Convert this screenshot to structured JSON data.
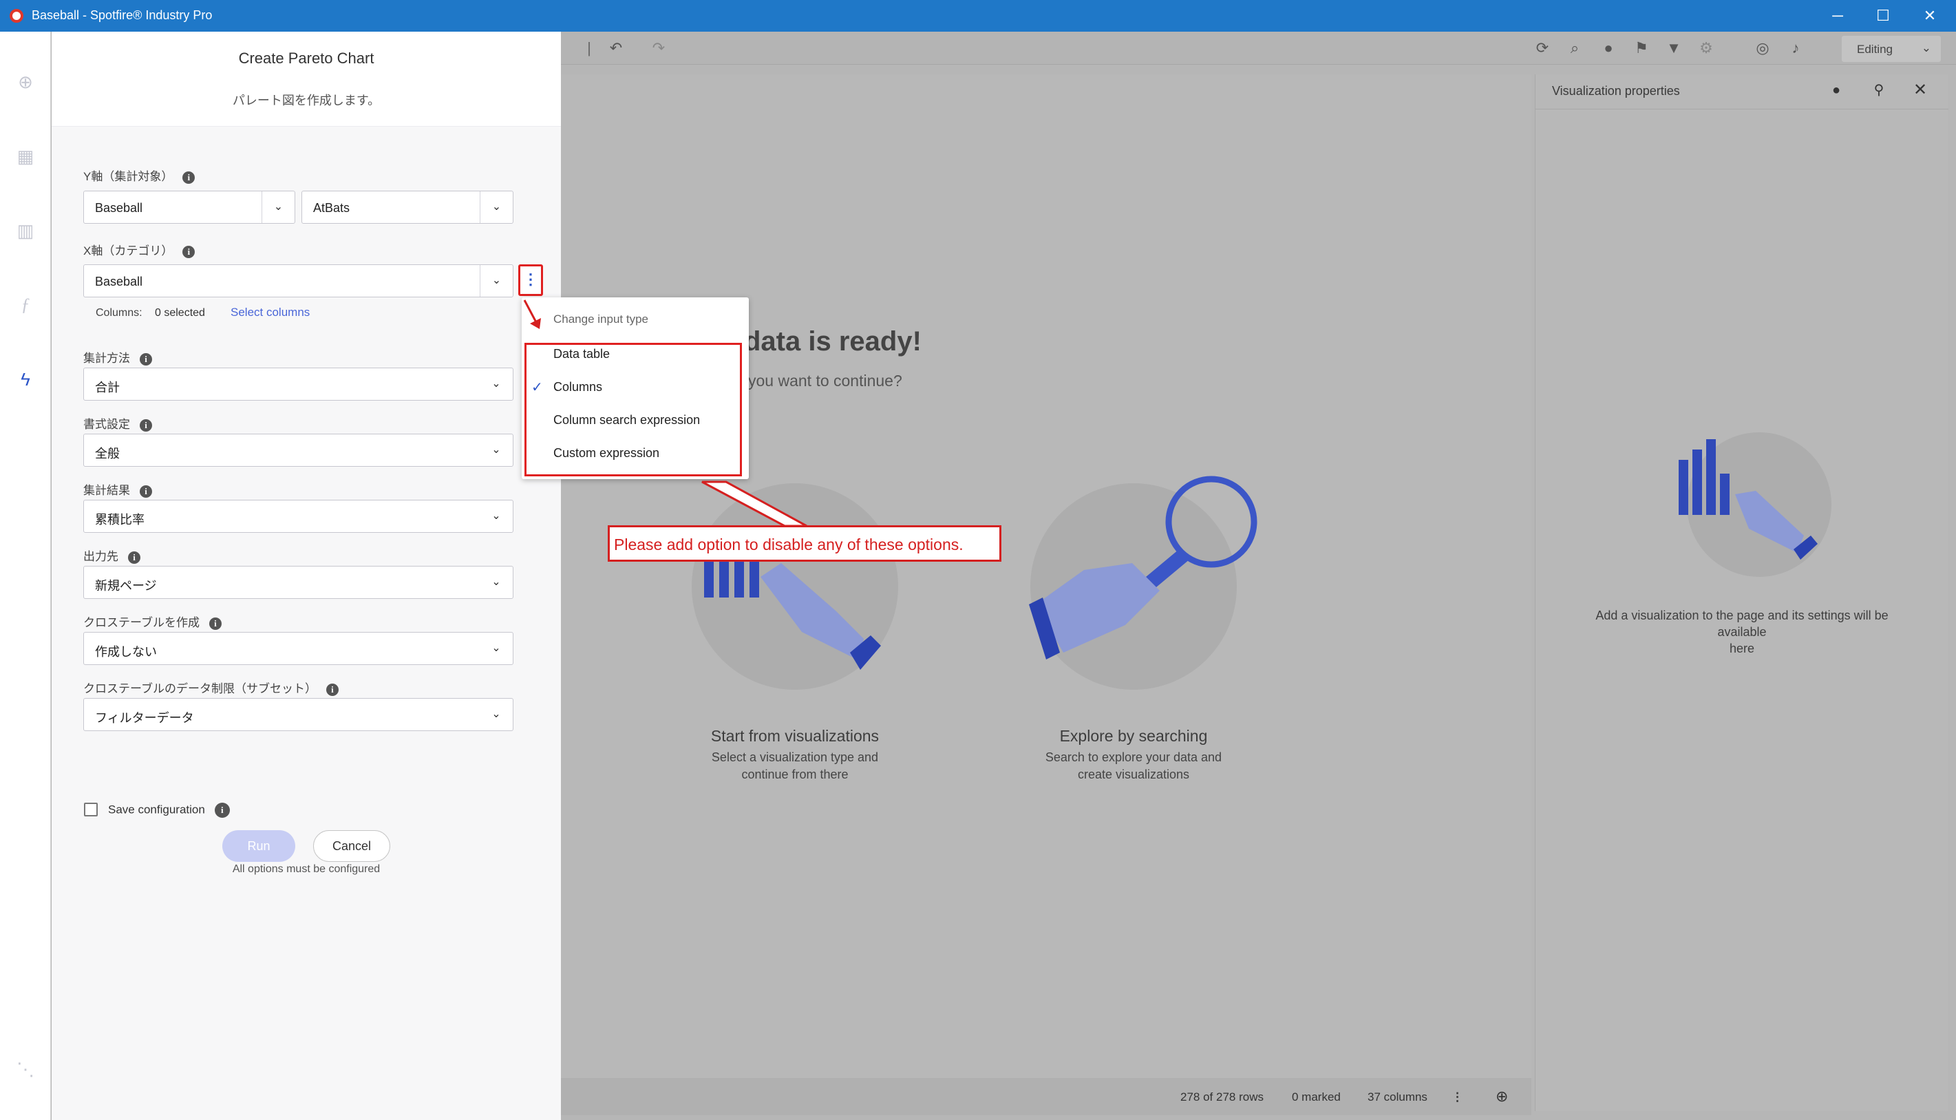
{
  "window": {
    "title": "Baseball - Spotfire® Industry Pro",
    "icons": [
      "app-icon",
      "minimize-icon",
      "maximize-icon",
      "close-icon"
    ]
  },
  "rail": {
    "icons": [
      "add-icon",
      "data-table-icon",
      "bar-chart-icon",
      "formula-icon",
      "lightning-icon",
      "tree-icon"
    ]
  },
  "toolbar": {
    "icons": [
      "undo-icon",
      "redo-icon",
      "refresh-icon",
      "search-icon",
      "comment-icon",
      "bookmark-icon",
      "filter-icon",
      "gear-icon",
      "compass-icon",
      "bell-icon"
    ],
    "mode_label": "Editing"
  },
  "dialog": {
    "title": "Create Pareto Chart",
    "subtitle": "パレート図を作成します。",
    "y_axis": {
      "label": "Y軸（集計対象）",
      "table_value": "Baseball",
      "column_value": "AtBats"
    },
    "x_axis": {
      "label": "X軸（カテゴリ）",
      "table_value": "Baseball",
      "columns_label": "Columns:",
      "columns_selected": "0 selected",
      "select_columns_link": "Select columns"
    },
    "aggregation": {
      "label": "集計方法",
      "value": "合計"
    },
    "format": {
      "label": "書式設定",
      "value": "全般"
    },
    "result": {
      "label": "集計結果",
      "value": "累積比率"
    },
    "output": {
      "label": "出力先",
      "value": "新規ページ"
    },
    "crosstable": {
      "label": "クロステーブルを作成",
      "value": "作成しない"
    },
    "crosstable_limit": {
      "label": "クロステーブルのデータ制限（サブセット）",
      "value": "フィルターデータ"
    },
    "save_config_label": "Save configuration",
    "run_label": "Run",
    "cancel_label": "Cancel",
    "footer_note": "All options must be configured"
  },
  "menu": {
    "header": "Change input type",
    "items": [
      "Data table",
      "Columns",
      "Column search expression",
      "Custom expression"
    ],
    "selected_item": "Columns"
  },
  "callout": {
    "text": "Please add option to disable any of these options."
  },
  "canvas": {
    "title": "data is ready!",
    "subtitle": "you want to continue?",
    "card1": {
      "title": "Start from visualizations",
      "desc_line1": "Select a visualization type and",
      "desc_line2": "continue from there"
    },
    "card2": {
      "title": "Explore by searching",
      "desc_line1": "Search to explore your data and",
      "desc_line2": "create visualizations"
    }
  },
  "statusbar": {
    "rows": "278 of 278 rows",
    "marked": "0 marked",
    "columns": "37 columns"
  },
  "viz_properties": {
    "title": "Visualization properties",
    "empty_line1": "Add a visualization to the page and its settings will be available",
    "empty_line2": "here"
  },
  "colors": {
    "titlebar": "#1f78c8",
    "accent_blue": "#2d56c8",
    "annotation_red": "#e02020",
    "run_disabled": "#c7cdf4"
  }
}
